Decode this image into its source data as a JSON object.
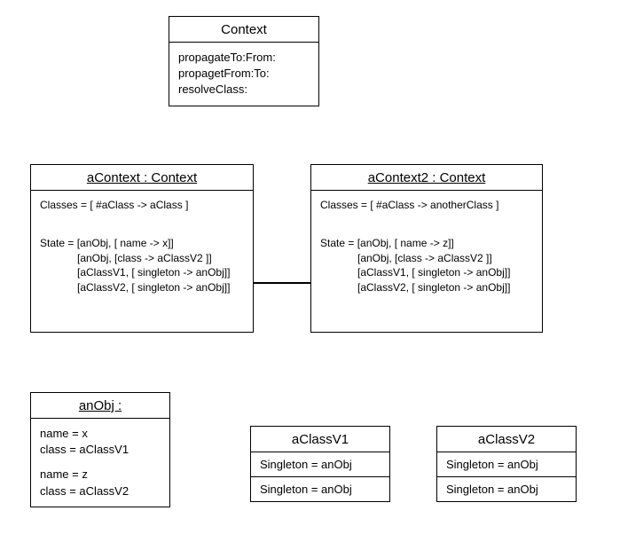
{
  "context_class": {
    "name": "Context",
    "ops": [
      "propagateTo:From:",
      "propagetFrom:To:",
      "resolveClass:"
    ]
  },
  "aContext": {
    "title": "aContext : Context",
    "classes_label": "Classes = [ #aClass -> aClass ]",
    "state_label": "State = [anObj, [ name -> x]]",
    "state_lines": [
      "[anObj, [class -> aClassV2 ]]",
      "[aClassV1, [ singleton -> anObj]]",
      "[aClassV2, [ singleton -> anObj]]"
    ]
  },
  "aContext2": {
    "title": "aContext2 : Context",
    "classes_label": "Classes = [ #aClass -> anotherClass ]",
    "state_label": "State = [anObj, [ name -> z]]",
    "state_lines": [
      "[anObj, [class -> aClassV2 ]]",
      "[aClassV1, [ singleton -> anObj]]",
      "[aClassV2, [ singleton -> anObj]]"
    ]
  },
  "anObj": {
    "title": "anObj :",
    "lines": [
      "name = x",
      "class = aClassV1",
      "",
      "name = z",
      "class = aClassV2"
    ]
  },
  "aClassV1": {
    "title": "aClassV1",
    "rows": [
      "Singleton = anObj",
      "Singleton = anObj"
    ]
  },
  "aClassV2": {
    "title": "aClassV2",
    "rows": [
      "Singleton = anObj",
      "Singleton = anObj"
    ]
  },
  "chart_data": {
    "type": "table",
    "description": "UML-style class/object diagram",
    "nodes": [
      {
        "id": "Context",
        "kind": "class",
        "name": "Context",
        "operations": [
          "propagateTo:From:",
          "propagetFrom:To:",
          "resolveClass:"
        ]
      },
      {
        "id": "aContext",
        "kind": "object",
        "name": "aContext",
        "type": "Context",
        "slots": {
          "Classes": "[ #aClass -> aClass ]",
          "State": [
            "[anObj, [ name -> x]]",
            "[anObj, [class -> aClassV2 ]]",
            "[aClassV1, [ singleton -> anObj]]",
            "[aClassV2, [ singleton -> anObj]]"
          ]
        }
      },
      {
        "id": "aContext2",
        "kind": "object",
        "name": "aContext2",
        "type": "Context",
        "slots": {
          "Classes": "[ #aClass -> anotherClass ]",
          "State": [
            "[anObj, [ name -> z]]",
            "[anObj, [class -> aClassV2 ]]",
            "[aClassV1, [ singleton -> anObj]]",
            "[aClassV2, [ singleton -> anObj]]"
          ]
        }
      },
      {
        "id": "anObj",
        "kind": "object",
        "name": "anObj",
        "type": "",
        "slots": {
          "name": [
            "x",
            "z"
          ],
          "class": [
            "aClassV1",
            "aClassV2"
          ]
        }
      },
      {
        "id": "aClassV1",
        "kind": "object",
        "name": "aClassV1",
        "slots": {
          "Singleton": [
            "anObj",
            "anObj"
          ]
        }
      },
      {
        "id": "aClassV2",
        "kind": "object",
        "name": "aClassV2",
        "slots": {
          "Singleton": [
            "anObj",
            "anObj"
          ]
        }
      }
    ],
    "edges": [
      {
        "from": "aContext",
        "to": "aContext2",
        "kind": "association"
      }
    ]
  }
}
